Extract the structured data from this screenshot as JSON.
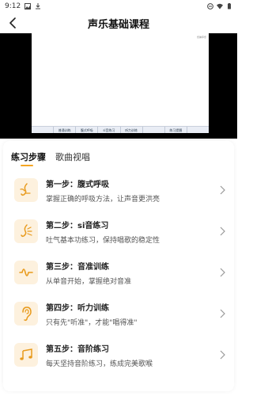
{
  "status": {
    "time": "9:12"
  },
  "app": {
    "title": "声乐基础课程"
  },
  "video": {
    "logo": "乐律声乐",
    "tabs": [
      "",
      "普通训练",
      "腹式呼吸",
      "si音练习",
      "听力训练",
      "",
      "练习提醒",
      ""
    ]
  },
  "tabs": [
    {
      "label": "练习步骤",
      "active": true
    },
    {
      "label": "歌曲视唱",
      "active": false
    }
  ],
  "steps": [
    {
      "title": "第一步：腹式呼吸",
      "desc": "掌握正确的呼吸方法，让声音更洪亮",
      "icon": "breathing-icon"
    },
    {
      "title": "第二步：si音练习",
      "desc": "吐气基本功练习，保持唱歌的稳定性",
      "icon": "si-sound-icon"
    },
    {
      "title": "第三步：音准训练",
      "desc": "从单音开始，掌握绝对音准",
      "icon": "pitch-wave-icon"
    },
    {
      "title": "第四步：听力训练",
      "desc": "只有先\"听准\"，才能\"唱得准\"",
      "icon": "ear-icon"
    },
    {
      "title": "第五步：音阶练习",
      "desc": "每天坚持音阶练习，练成完美歌喉",
      "icon": "music-notes-icon"
    }
  ],
  "colors": {
    "accent": "#f5a623",
    "icon_bg": "#fdf1de"
  }
}
